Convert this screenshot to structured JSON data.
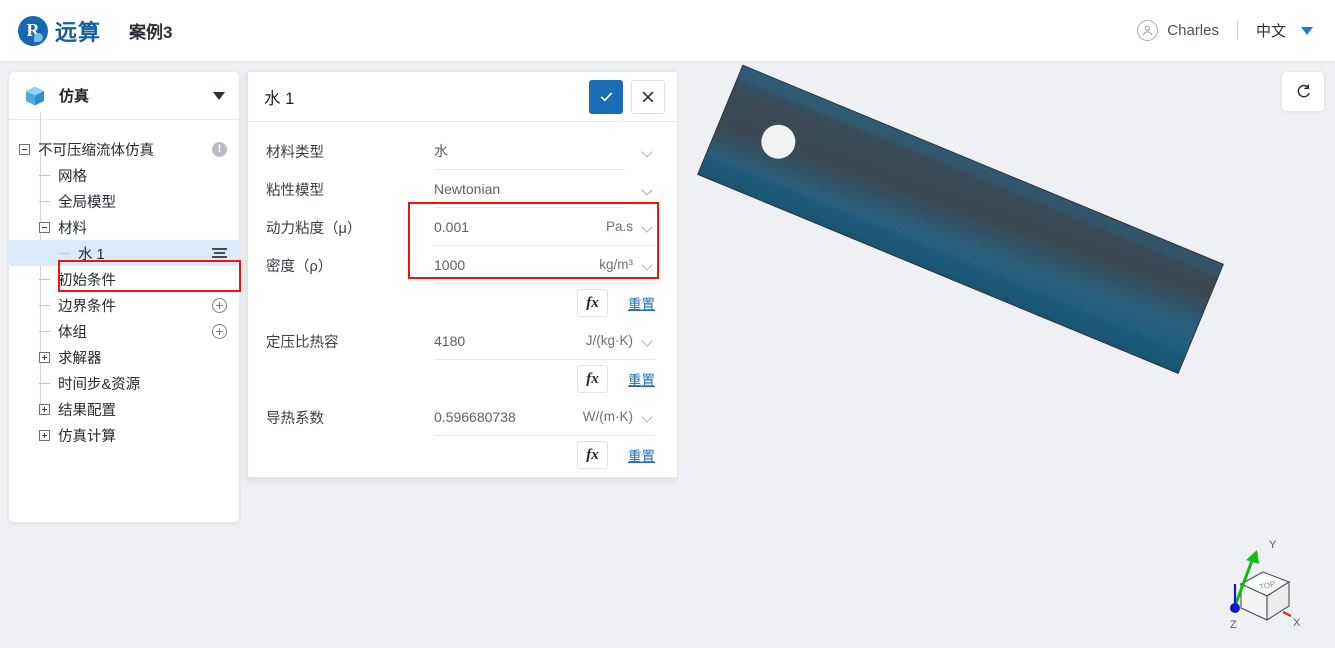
{
  "topbar": {
    "brand_glyph": "R",
    "brand_name": "远算",
    "case_title": "案例3",
    "user_name": "Charles",
    "avatar_icon": "user-circle-icon",
    "language": "中文",
    "lang_caret_icon": "chevron-down-icon",
    "lang_caret_color": "#1a7fd4"
  },
  "sidebar": {
    "header": {
      "icon": "cube-icon",
      "label": "仿真",
      "caret_icon": "chevron-down-icon"
    },
    "tree": [
      {
        "label": "不可压缩流体仿真",
        "depth": 0,
        "toggle": "minus",
        "badge": "warning-icon",
        "selected": false
      },
      {
        "label": "网格",
        "depth": 1,
        "toggle": "stub",
        "badge": "",
        "selected": false
      },
      {
        "label": "全局模型",
        "depth": 1,
        "toggle": "stub",
        "badge": "",
        "selected": false
      },
      {
        "label": "材料",
        "depth": 1,
        "toggle": "minus",
        "badge": "",
        "selected": false
      },
      {
        "label": "水 1",
        "depth": 2,
        "toggle": "stub",
        "badge": "menu-icon",
        "selected": true
      },
      {
        "label": "初始条件",
        "depth": 1,
        "toggle": "stub",
        "badge": "",
        "selected": false
      },
      {
        "label": "边界条件",
        "depth": 1,
        "toggle": "stub",
        "badge": "plus-circle-icon",
        "selected": false
      },
      {
        "label": "体组",
        "depth": 1,
        "toggle": "stub",
        "badge": "plus-circle-icon",
        "selected": false
      },
      {
        "label": "求解器",
        "depth": 1,
        "toggle": "plus",
        "badge": "",
        "selected": false
      },
      {
        "label": "时间步&资源",
        "depth": 1,
        "toggle": "stub",
        "badge": "",
        "selected": false
      },
      {
        "label": "结果配置",
        "depth": 1,
        "toggle": "plus",
        "badge": "",
        "selected": false
      },
      {
        "label": "仿真计算",
        "depth": 1,
        "toggle": "plus",
        "badge": "",
        "selected": false
      }
    ]
  },
  "panel": {
    "title": "水 1",
    "confirm_icon": "check-icon",
    "cancel_icon": "close-icon",
    "confirm_color": "#1a6cb5",
    "rows": [
      {
        "label": "材料类型",
        "value": "水",
        "unit": "",
        "type": "select"
      },
      {
        "label": "粘性模型",
        "value": "Newtonian",
        "unit": "",
        "type": "select"
      },
      {
        "label": "动力粘度（μ）",
        "value": "0.001",
        "unit": "Pa.s",
        "type": "value"
      },
      {
        "label": "密度（ρ）",
        "value": "1000",
        "unit": "kg/m³",
        "type": "value"
      },
      {
        "label": "定压比热容",
        "value": "4180",
        "unit": "J/(kg·K)",
        "type": "value"
      },
      {
        "label": "导热系数",
        "value": "0.596680738",
        "unit": "W/(m·K)",
        "type": "value"
      }
    ],
    "fx_label": "fx",
    "reset_label": "重置"
  },
  "viewport": {
    "reset_view_icon": "rotate-refresh-icon",
    "axes": {
      "x": "X",
      "y": "Y",
      "z": "Z",
      "cube_face": "TOP"
    },
    "axis_colors": {
      "x": "#d42b2b",
      "y": "#16b816",
      "z": "#1515c8"
    },
    "mesh_color": "#3a4650",
    "mesh_accent": "#1d5f7e"
  },
  "annotations": {
    "highlight_color": "#f4130c"
  }
}
